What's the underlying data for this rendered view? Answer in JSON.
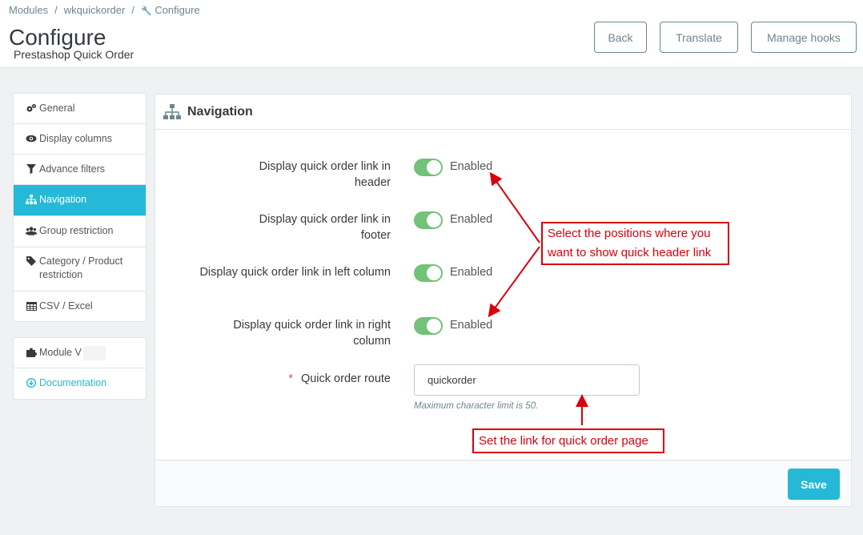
{
  "breadcrumb": {
    "item1": "Modules",
    "item2": "wkquickorder",
    "item3": "Configure",
    "separator": "/"
  },
  "page": {
    "title": "Configure",
    "subtitle": "Prestashop Quick Order"
  },
  "toolbar": {
    "back": "Back",
    "translate": "Translate",
    "manage_hooks": "Manage hooks"
  },
  "menu": {
    "items": [
      {
        "label": "General",
        "icon": "cogs-icon"
      },
      {
        "label": "Display columns",
        "icon": "eye-icon"
      },
      {
        "label": "Advance filters",
        "icon": "filter-icon"
      },
      {
        "label": "Navigation",
        "icon": "sitemap-icon",
        "active": true
      },
      {
        "label": "Group restriction",
        "icon": "users-icon"
      },
      {
        "label": "Category / Product restriction",
        "icon": "tag-icon"
      },
      {
        "label": "CSV / Excel",
        "icon": "table-icon"
      }
    ]
  },
  "menu2": {
    "module_version": "Module V",
    "documentation": "Documentation"
  },
  "panel": {
    "title": "Navigation",
    "rows": [
      {
        "label": "Display quick order link in header",
        "state": "Enabled"
      },
      {
        "label": "Display quick order link in footer",
        "state": "Enabled"
      },
      {
        "label": "Display quick order link in left column",
        "state": "Enabled"
      },
      {
        "label": "Display quick order link in right column",
        "state": "Enabled"
      }
    ],
    "route": {
      "required_mark": "*",
      "label": "Quick order route",
      "value": "quickorder",
      "help": "Maximum character limit is 50."
    },
    "save": "Save"
  },
  "annotations": {
    "positions": "Select the positions where you want to show quick header link",
    "route": "Set the link for quick order page"
  },
  "colors": {
    "accent": "#25b9d7",
    "switch_on": "#72c279",
    "annotation": "#d8000c"
  }
}
